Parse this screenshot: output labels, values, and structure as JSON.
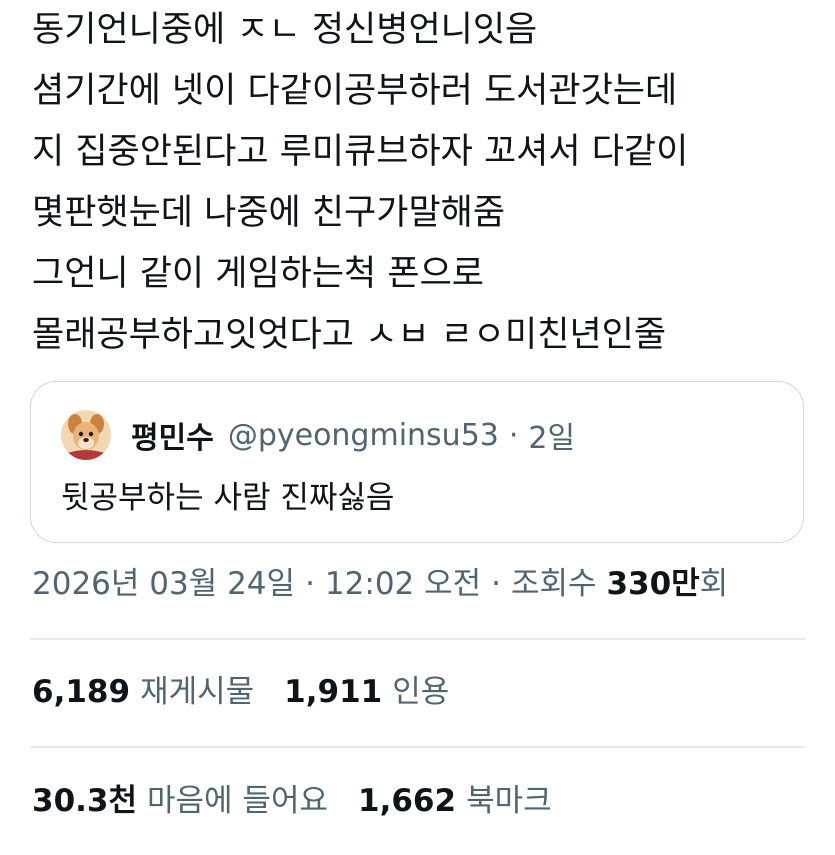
{
  "tweet": {
    "lines": [
      "동기언니중에 ㅈㄴ 정신병언니잇음",
      "셤기간에 넷이 다같이공부하러 도서관갓는데",
      "지 집중안된다고 루미큐브하자 꼬셔서 다같이",
      "몇판햇눈데 나중에 친구가말해줌",
      "그언니 같이 게임하는척 폰으로",
      "몰래공부하고잇엇다고 ㅅㅂ ㄹㅇ미친년인줄"
    ]
  },
  "quote": {
    "avatar_icon": "dog-avatar-icon",
    "name": "평민수",
    "handle": "@pyeongminsu53",
    "dot": "·",
    "time": "2일",
    "text": "뒷공부하는 사람 진짜싫음"
  },
  "meta": {
    "date": "2026년 03월 24일",
    "dot1": "·",
    "time": "12:02 오전",
    "dot2": "·",
    "views_label_prefix": "조회수",
    "views_number": "330만",
    "views_label_suffix": "회"
  },
  "stats": {
    "retweets_count": "6,189",
    "retweets_label": "재게시물",
    "quotes_count": "1,911",
    "quotes_label": "인용",
    "likes_count": "30.3천",
    "likes_label": "마음에 들어요",
    "bookmarks_count": "1,662",
    "bookmarks_label": "북마크"
  },
  "colors": {
    "text_primary": "#0f1419",
    "text_secondary": "#536471",
    "border": "#cfd9de",
    "divider": "#e7eaec"
  }
}
